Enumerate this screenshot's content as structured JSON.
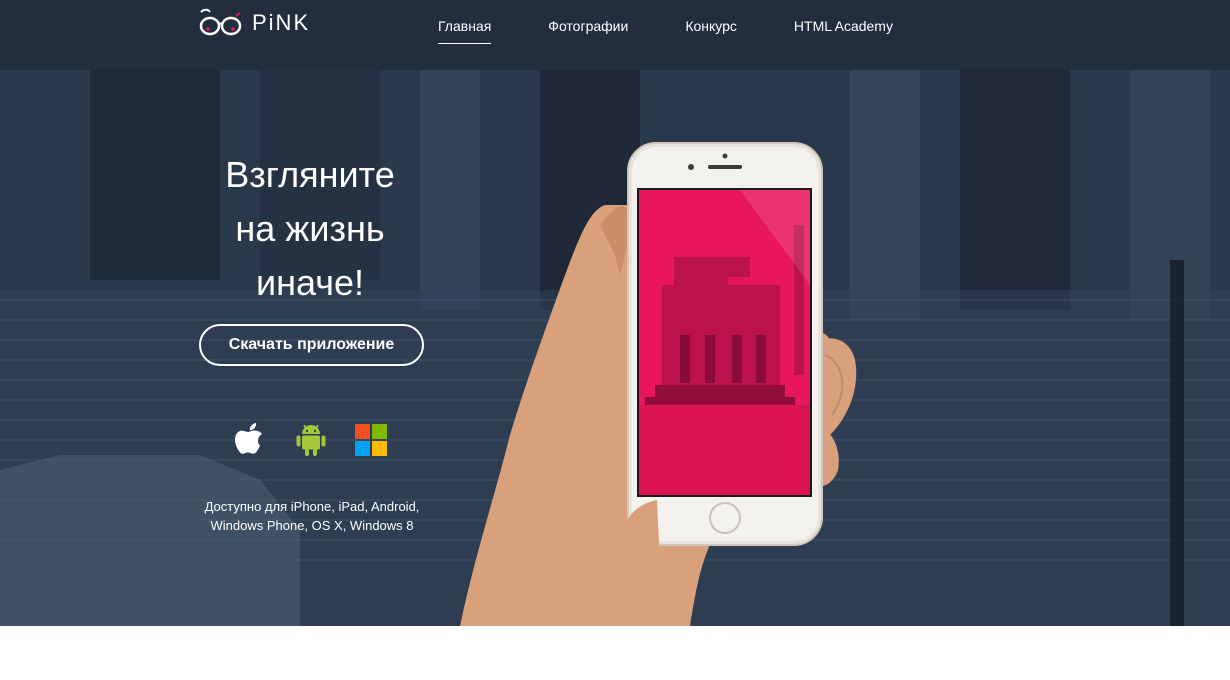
{
  "brand": {
    "name": "PiNK"
  },
  "nav": {
    "items": [
      {
        "label": "Главная",
        "active": true
      },
      {
        "label": "Фотографии",
        "active": false
      },
      {
        "label": "Конкурс",
        "active": false
      },
      {
        "label": "HTML Academy",
        "active": false
      }
    ]
  },
  "hero": {
    "headline_lines": [
      "Взгляните",
      "на жизнь",
      "иначе!"
    ],
    "download_label": "Скачать приложение",
    "platforms": [
      {
        "icon": "apple-icon"
      },
      {
        "icon": "android-icon"
      },
      {
        "icon": "windows-icon"
      }
    ],
    "availability_lines": [
      "Доступно для iPhone, iPad, Android,",
      "Windows Phone, OS X, Windows 8"
    ]
  },
  "colors": {
    "accent": "#e8175d",
    "background": "#2b3a4e",
    "header": "#1c2634",
    "android": "#a4c639"
  }
}
